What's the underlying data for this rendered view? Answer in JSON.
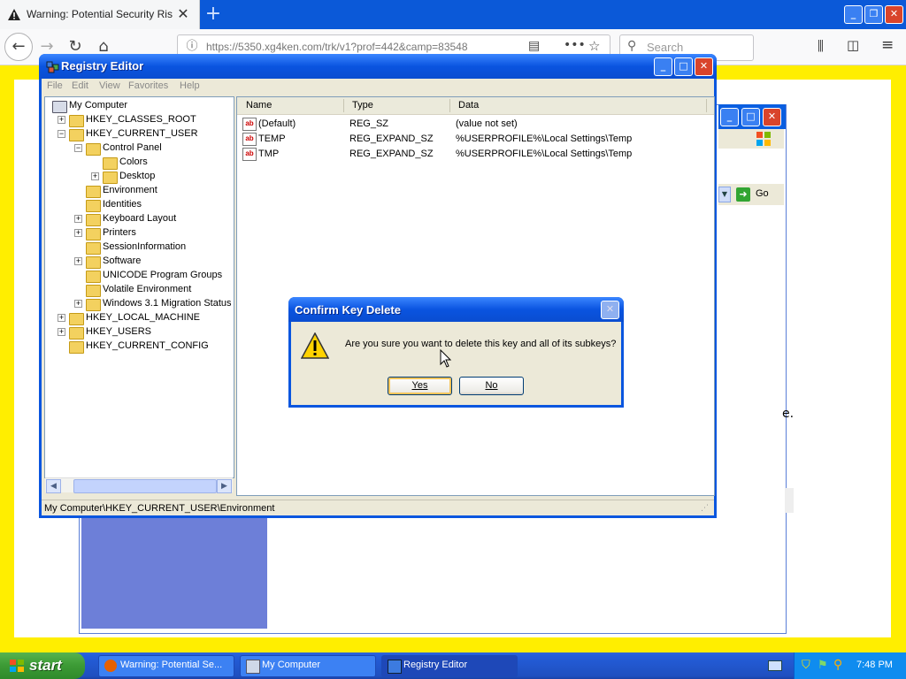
{
  "browser": {
    "tab_title": "Warning: Potential Security Risk Ah",
    "url": "https://5350.xg4ken.com/trk/v1?prof=442&camp=83548",
    "search_placeholder": "Search"
  },
  "background_window": {
    "go_label": "Go",
    "fragment_text": "e."
  },
  "regedit": {
    "title": "Registry Editor",
    "menu": [
      "File",
      "Edit",
      "View",
      "Favorites",
      "Help"
    ],
    "tree": [
      {
        "label": "My Computer",
        "indent": 0,
        "expander": "",
        "selected": false
      },
      {
        "label": "HKEY_CLASSES_ROOT",
        "indent": 1,
        "expander": "+",
        "selected": false
      },
      {
        "label": "HKEY_CURRENT_USER",
        "indent": 1,
        "expander": "-",
        "selected": false
      },
      {
        "label": "Control Panel",
        "indent": 2,
        "expander": "-",
        "selected": false
      },
      {
        "label": "Colors",
        "indent": 3,
        "expander": "",
        "selected": false
      },
      {
        "label": "Desktop",
        "indent": 3,
        "expander": "+",
        "selected": false
      },
      {
        "label": "Environment",
        "indent": 2,
        "expander": "",
        "selected": false
      },
      {
        "label": "Identities",
        "indent": 2,
        "expander": "",
        "selected": false
      },
      {
        "label": "Keyboard Layout",
        "indent": 2,
        "expander": "+",
        "selected": false
      },
      {
        "label": "Printers",
        "indent": 2,
        "expander": "+",
        "selected": false
      },
      {
        "label": "SessionInformation",
        "indent": 2,
        "expander": "",
        "selected": false
      },
      {
        "label": "Software",
        "indent": 2,
        "expander": "+",
        "selected": false
      },
      {
        "label": "UNICODE Program Groups",
        "indent": 2,
        "expander": "",
        "selected": false
      },
      {
        "label": "Volatile Environment",
        "indent": 2,
        "expander": "",
        "selected": false
      },
      {
        "label": "Windows 3.1 Migration Status",
        "indent": 2,
        "expander": "+",
        "selected": false
      },
      {
        "label": "HKEY_LOCAL_MACHINE",
        "indent": 1,
        "expander": "+",
        "selected": false
      },
      {
        "label": "HKEY_USERS",
        "indent": 1,
        "expander": "+",
        "selected": false
      },
      {
        "label": "HKEY_CURRENT_CONFIG",
        "indent": 1,
        "expander": "",
        "selected": false
      }
    ],
    "columns": [
      "Name",
      "Type",
      "Data"
    ],
    "values": [
      {
        "name": "(Default)",
        "type": "REG_SZ",
        "data": "(value not set)"
      },
      {
        "name": "TEMP",
        "type": "REG_EXPAND_SZ",
        "data": "%USERPROFILE%\\Local Settings\\Temp"
      },
      {
        "name": "TMP",
        "type": "REG_EXPAND_SZ",
        "data": "%USERPROFILE%\\Local Settings\\Temp"
      }
    ],
    "status": "My Computer\\HKEY_CURRENT_USER\\Environment"
  },
  "dialog": {
    "title": "Confirm Key Delete",
    "message": "Are you sure you want to delete this key and all of its subkeys?",
    "yes_label": "Yes",
    "no_label": "No"
  },
  "taskbar": {
    "start_label": "start",
    "items": [
      {
        "label": "Warning: Potential Se...",
        "active": false
      },
      {
        "label": "My Computer",
        "active": false
      },
      {
        "label": "Registry Editor",
        "active": true
      }
    ],
    "clock": "7:48 PM"
  },
  "colors": {
    "xp_blue": "#0a56df",
    "warning_yellow": "#ffee00",
    "start_green": "#3c9a35"
  }
}
